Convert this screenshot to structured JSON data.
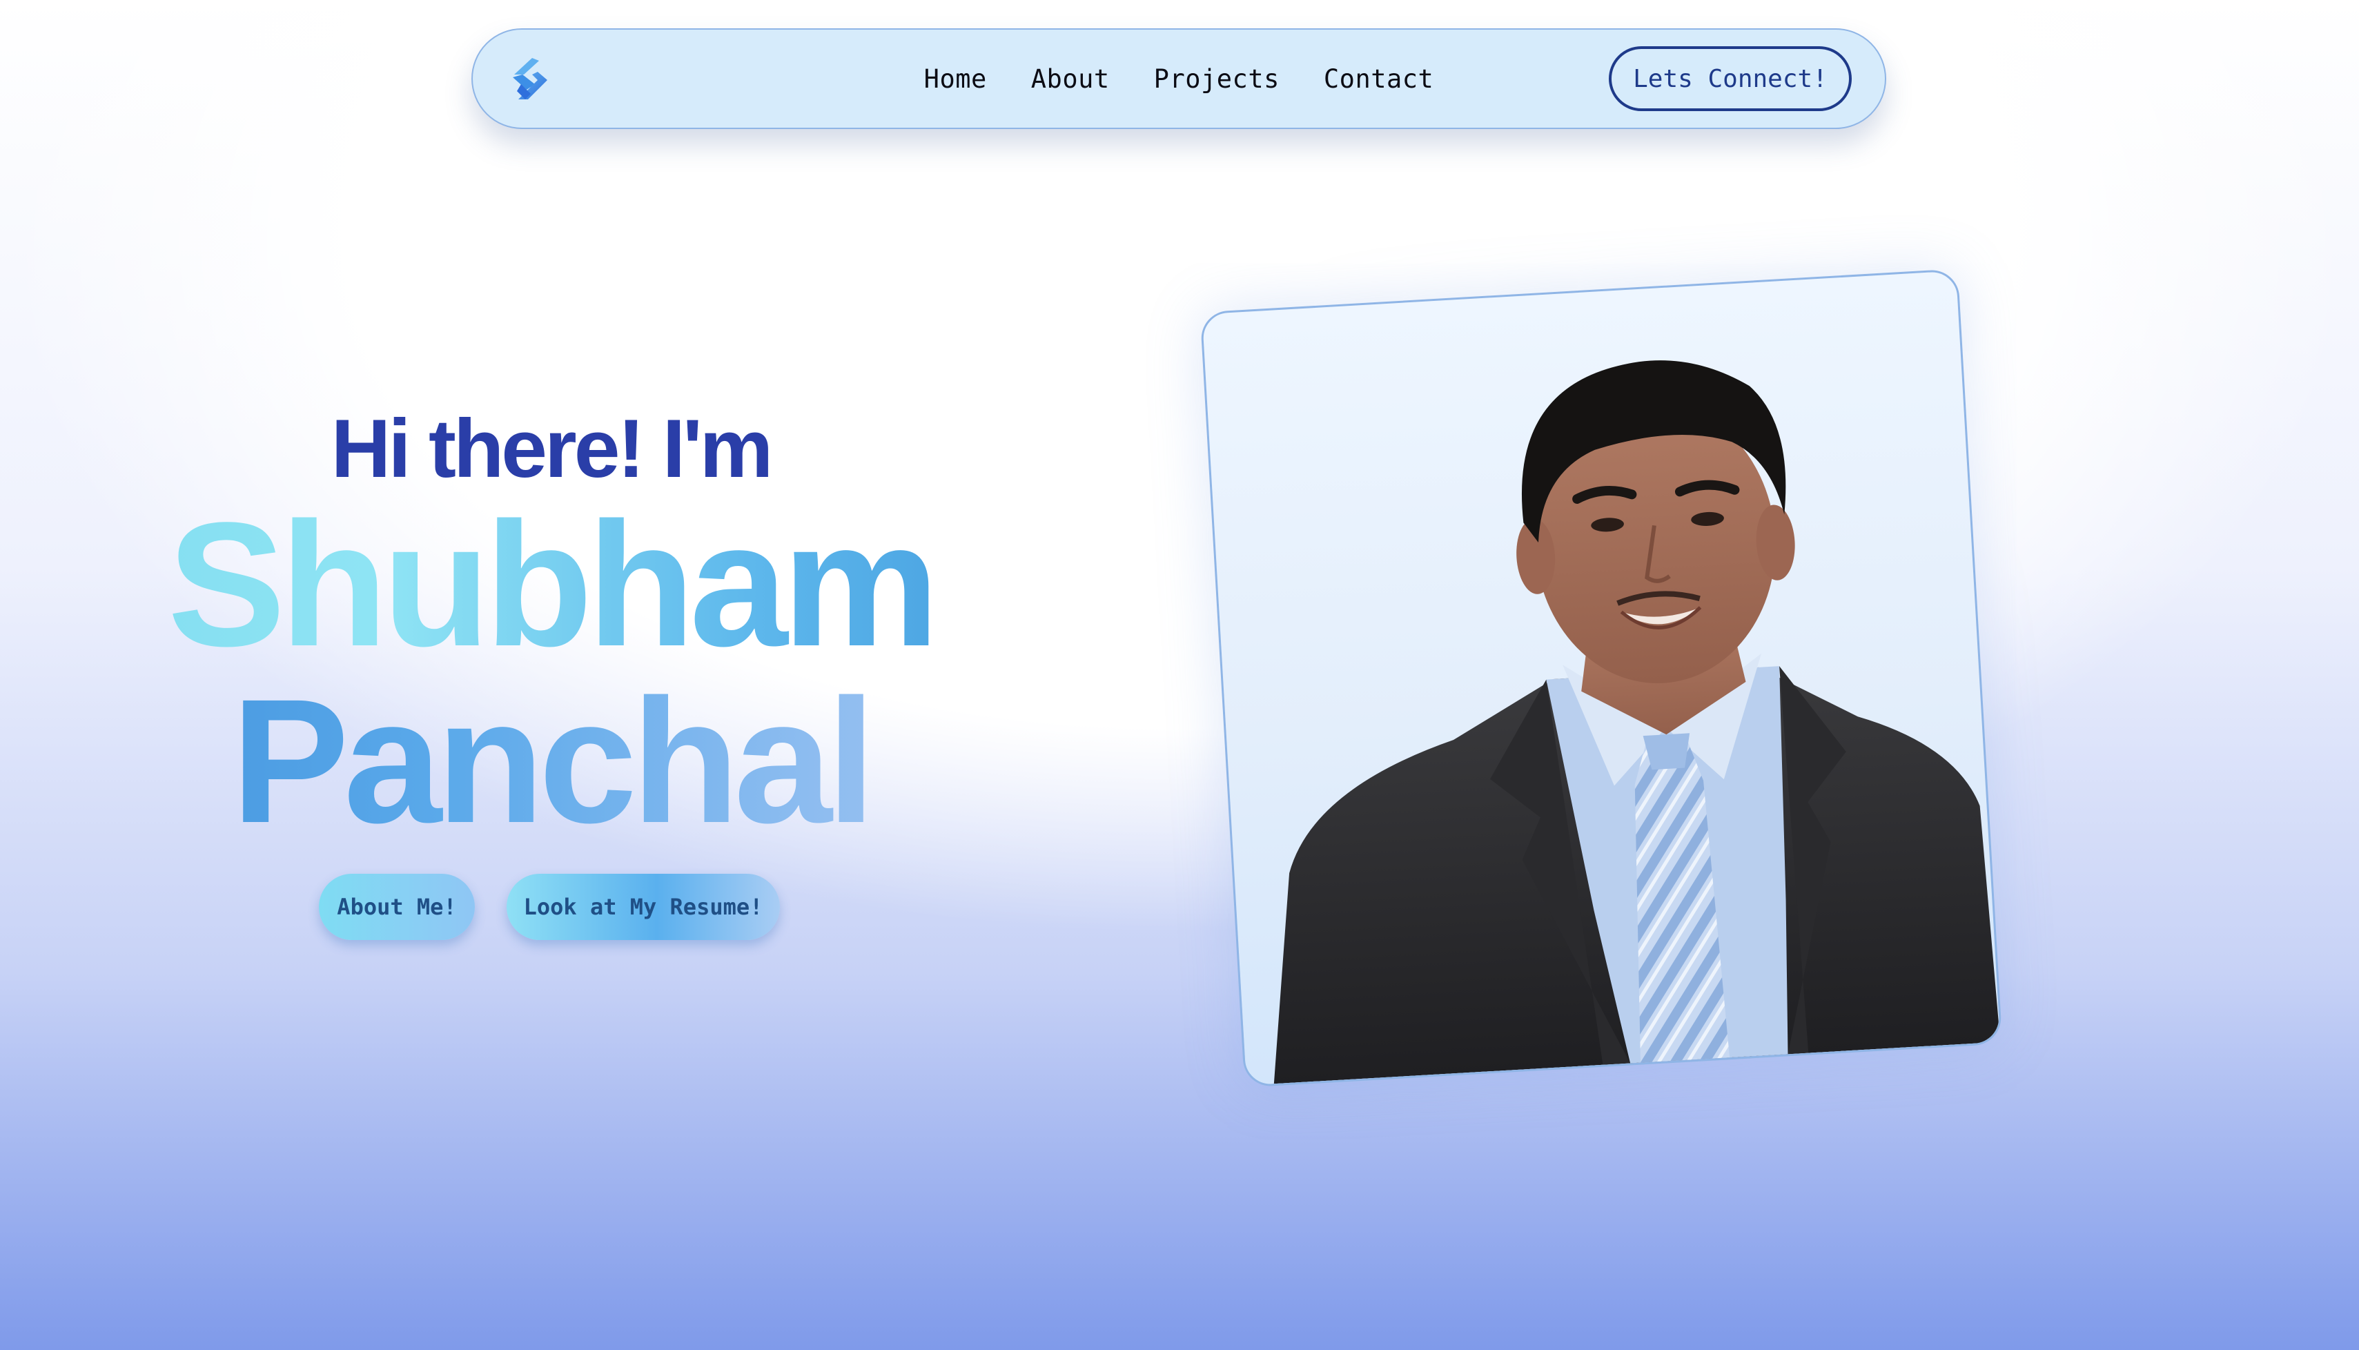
{
  "nav": {
    "logo_icon": "s-monogram-logo-icon",
    "links": [
      "Home",
      "About",
      "Projects",
      "Contact"
    ],
    "cta_label": "Lets Connect!"
  },
  "hero": {
    "greeting": "Hi there! I'm",
    "first_name": "Shubham",
    "last_name": "Panchal",
    "buttons": {
      "about": "About Me!",
      "resume": "Look at My Resume!"
    }
  },
  "portrait": {
    "subject": "portrait-photo"
  },
  "colors": {
    "nav_bg": "#d6ebfb",
    "nav_border": "#8fb5e6",
    "cta_text": "#1e3a8a",
    "greeting": "#2a3ea8",
    "name_gradient_start": "#7fdcef",
    "name_gradient_end": "#3f97dc",
    "page_bottom": "#7f9aea"
  }
}
